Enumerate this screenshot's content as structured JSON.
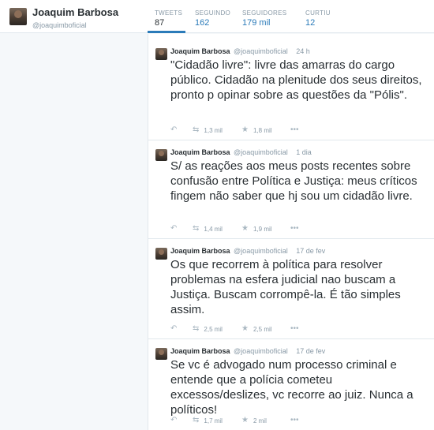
{
  "profile": {
    "name": "Joaquim Barbosa",
    "handle": "@joaquimboficial"
  },
  "stats": [
    {
      "label": "TWEETS",
      "value": "87"
    },
    {
      "label": "SEGUINDO",
      "value": "162"
    },
    {
      "label": "SEGUIDORES",
      "value": "179 mil"
    },
    {
      "label": "CURTIU",
      "value": "12"
    }
  ],
  "tweets": [
    {
      "name": "Joaquim Barbosa",
      "handle": "@joaquimboficial",
      "time": "24 h",
      "text": "\"Cidadão livre\": livre das amarras do cargo público. Cidadão na plenitude dos seus direitos, pronto p opinar sobre as questões da \"Pólis\".",
      "retweets": "1,3 mil",
      "favorites": "1,8 mil"
    },
    {
      "name": "Joaquim Barbosa",
      "handle": "@joaquimboficial",
      "time": "1 dia",
      "text": "S/ as reações aos meus posts recentes sobre confusão entre Política e Justiça: meus críticos fingem não saber que hj sou um cidadão livre.",
      "retweets": "1,4 mil",
      "favorites": "1,9 mil"
    },
    {
      "name": "Joaquim Barbosa",
      "handle": "@joaquimboficial",
      "time": "17 de fev",
      "text": "Os que recorrem à política para resolver problemas na esfera judicial nao buscam a Justiça. Buscam corrompê-la. É tão simples assim.",
      "retweets": "2,5 mil",
      "favorites": "2,5 mil"
    },
    {
      "name": "Joaquim Barbosa",
      "handle": "@joaquimboficial",
      "time": "17 de fev",
      "text": "Se vc é advogado num processo criminal e entende que a polícia cometeu excessos/deslizes, vc recorre ao juiz. Nunca a políticos!",
      "retweets": "1,7 mil",
      "favorites": "2 mil"
    }
  ],
  "icons": {
    "reply": "reply-icon",
    "retweet": "retweet-icon",
    "favorite": "star-icon",
    "more": "more-icon"
  },
  "colors": {
    "accent": "#2b7bb9",
    "muted": "#8899a6",
    "text": "#292f33"
  }
}
